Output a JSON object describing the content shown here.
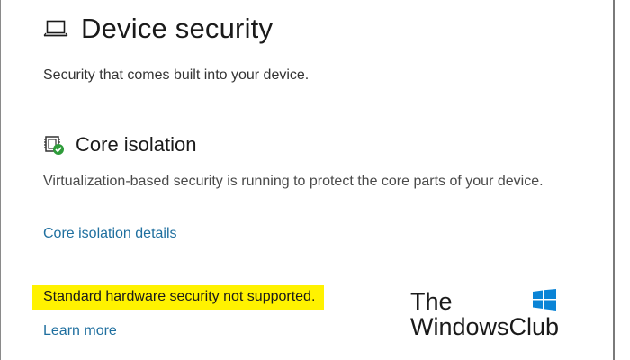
{
  "page": {
    "title": "Device security",
    "subtitle": "Security that comes built into your device."
  },
  "core_isolation": {
    "title": "Core isolation",
    "description": "Virtualization-based security is running to protect the core parts of your device.",
    "details_link": "Core isolation details"
  },
  "hardware": {
    "warning": "Standard hardware security not supported.",
    "learn_more_link": "Learn more"
  },
  "watermark": {
    "line1": "The",
    "line2": "WindowsClub"
  },
  "colors": {
    "link": "#1f6f9f",
    "highlight": "#fff200",
    "status_ok": "#2e9b3a",
    "logo": "#0a84d6"
  },
  "icons": {
    "page": "laptop-icon",
    "section": "chip-shield-check-icon",
    "watermark": "windows-logo-icon"
  }
}
